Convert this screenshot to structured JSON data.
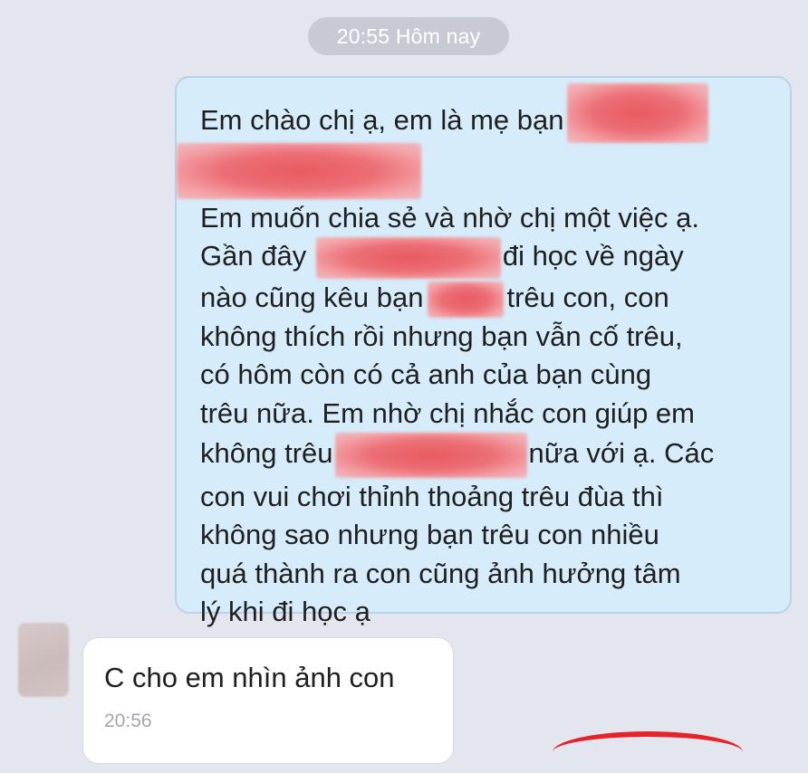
{
  "conversation": {
    "date_separator": "20:55 Hôm nay",
    "sent_message": {
      "line1": "Em chào chị ạ, em là mẹ bạn",
      "line3": "Em muốn chia sẻ và nhờ chị một việc ạ.",
      "line4_a": "Gần đây",
      "line4_b": "đi học về ngày",
      "line5_a": "nào cũng kêu bạn",
      "line5_b": "trêu con, con",
      "line6": "không thích rồi nhưng bạn vẫn cố trêu,",
      "line7": "có hôm còn có cả anh của bạn cùng",
      "line8": "trêu nữa. Em nhờ chị nhắc con giúp em",
      "line9_a": "không trêu",
      "line9_b": "nữa với ạ. Các",
      "line10": "con vui chơi thỉnh thoảng trêu đùa thì",
      "line11": "không sao nhưng bạn trêu con nhiều",
      "line12": "quá thành ra con cũng ảnh hưởng tâm",
      "line13": "lý khi đi học ạ"
    },
    "received_message": {
      "text": "C cho em nhìn ảnh con",
      "time": "20:56"
    }
  },
  "colors": {
    "background": "#e4e6ef",
    "sent_bubble": "#d6ecfa",
    "received_bubble": "#ffffff",
    "redaction": "#ec6f76",
    "annotation_red": "#e5232a"
  }
}
